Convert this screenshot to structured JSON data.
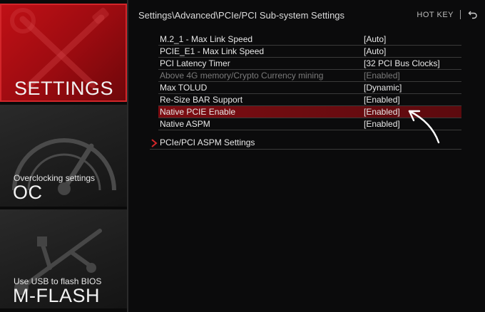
{
  "sidebar": {
    "settings": {
      "title": "SETTINGS"
    },
    "oc": {
      "subtitle": "Overclocking settings",
      "title": "OC"
    },
    "mflash": {
      "subtitle": "Use USB to flash BIOS",
      "title": "M-FLASH"
    }
  },
  "header": {
    "breadcrumb": "Settings\\Advanced\\PCIe/PCI Sub-system Settings",
    "hotkey": "HOT KEY",
    "separator": "|"
  },
  "settings": [
    {
      "label": "M.2_1 - Max Link Speed",
      "value": "[Auto]",
      "state": "normal"
    },
    {
      "label": "PCIE_E1 - Max Link Speed",
      "value": "[Auto]",
      "state": "normal"
    },
    {
      "label": "PCI Latency Timer",
      "value": "[32 PCI Bus Clocks]",
      "state": "normal"
    },
    {
      "label": "Above 4G memory/Crypto Currency mining",
      "value": "[Enabled]",
      "state": "disabled"
    },
    {
      "label": "Max TOLUD",
      "value": "[Dynamic]",
      "state": "normal"
    },
    {
      "label": "Re-Size BAR Support",
      "value": "[Enabled]",
      "state": "normal"
    },
    {
      "label": "Native PCIE Enable",
      "value": "[Enabled]",
      "state": "selected"
    },
    {
      "label": "Native ASPM",
      "value": "[Enabled]",
      "state": "normal"
    }
  ],
  "submenu": {
    "label": "PCIe/PCI ASPM Settings"
  },
  "colors": {
    "accent": "#c01016",
    "selected_row": "#7d0d12",
    "text": "#e8e8e8",
    "disabled_text": "#7a7a7a"
  },
  "icons": {
    "settings_bg": "wrench-screwdriver-icon",
    "oc_bg": "speedometer-icon",
    "mflash_bg": "usb-icon",
    "back": "back-icon",
    "submenu": "chevron-right-icon",
    "annotation": "arrow-pointer-icon"
  }
}
